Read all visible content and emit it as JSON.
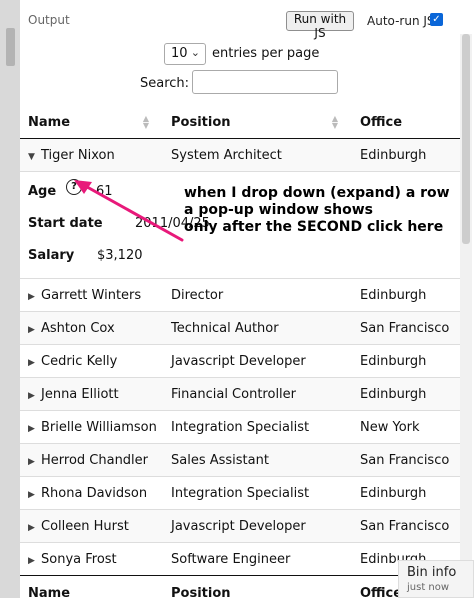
{
  "toolbar": {
    "output_label": "Output",
    "run_label": "Run with JS",
    "autorun_label": "Auto-run JS",
    "autorun_checked": true
  },
  "length": {
    "value": "10",
    "label": "entries per page"
  },
  "search": {
    "label": "Search:",
    "value": ""
  },
  "columns": [
    "Name",
    "Position",
    "Office"
  ],
  "expanded": {
    "name": "Tiger Nixon",
    "position": "System Architect",
    "office": "Edinburgh",
    "details": [
      {
        "label": "Age",
        "value": "61"
      },
      {
        "label": "Start date",
        "value": "2011/04/25"
      },
      {
        "label": "Salary",
        "value": "$3,120"
      }
    ]
  },
  "rows": [
    {
      "name": "Garrett Winters",
      "position": "Director",
      "office": "Edinburgh"
    },
    {
      "name": "Ashton Cox",
      "position": "Technical Author",
      "office": "San Francisco"
    },
    {
      "name": "Cedric Kelly",
      "position": "Javascript Developer",
      "office": "Edinburgh"
    },
    {
      "name": "Jenna Elliott",
      "position": "Financial Controller",
      "office": "Edinburgh"
    },
    {
      "name": "Brielle Williamson",
      "position": "Integration Specialist",
      "office": "New York"
    },
    {
      "name": "Herrod Chandler",
      "position": "Sales Assistant",
      "office": "San Francisco"
    },
    {
      "name": "Rhona Davidson",
      "position": "Integration Specialist",
      "office": "Edinburgh"
    },
    {
      "name": "Colleen Hurst",
      "position": "Javascript Developer",
      "office": "San Francisco"
    },
    {
      "name": "Sonya Frost",
      "position": "Software Engineer",
      "office": "Edinburgh"
    }
  ],
  "annotation": [
    "when I drop down (expand) a row",
    "a pop-up window shows",
    "only after the SECOND click here"
  ],
  "annotation_color": "#e8197a",
  "bin_info": {
    "title": "Bin info",
    "subtitle": "just now"
  }
}
